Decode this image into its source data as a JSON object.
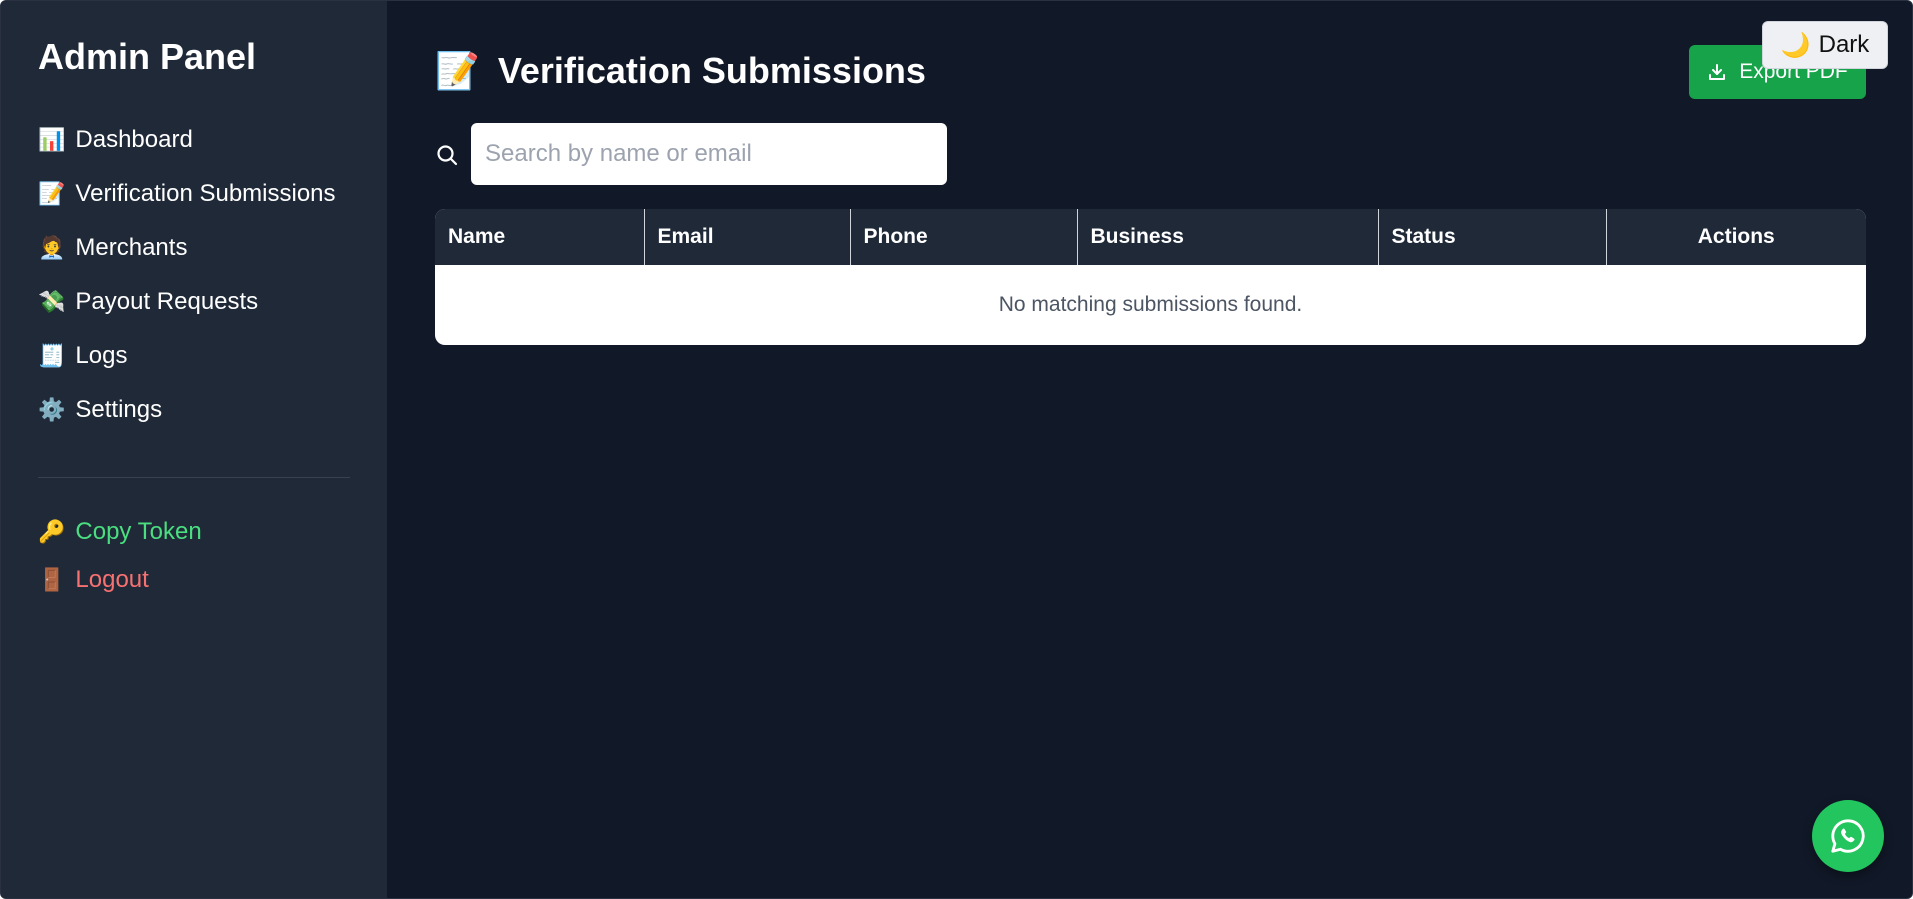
{
  "sidebar": {
    "brand": "Admin Panel",
    "items": [
      {
        "icon": "📊",
        "label": "Dashboard"
      },
      {
        "icon": "📝",
        "label": "Verification Submissions"
      },
      {
        "icon": "🧑‍💼",
        "label": "Merchants"
      },
      {
        "icon": "💸",
        "label": "Payout Requests"
      },
      {
        "icon": "🧾",
        "label": "Logs"
      },
      {
        "icon": "⚙️",
        "label": "Settings"
      }
    ],
    "copy_token": {
      "icon": "🔑",
      "label": "Copy Token"
    },
    "logout": {
      "icon": "🚪",
      "label": "Logout"
    }
  },
  "header": {
    "title_icon": "📝",
    "title": "Verification Submissions",
    "export_label": "Export PDF",
    "theme_icon": "🌙",
    "theme_label": "Dark"
  },
  "search": {
    "placeholder": "Search by name or email",
    "value": ""
  },
  "table": {
    "columns": [
      "Name",
      "Email",
      "Phone",
      "Business",
      "Status",
      "Actions"
    ],
    "empty_message": "No matching submissions found."
  },
  "colors": {
    "sidebar_bg": "#1f2937",
    "main_bg": "#111827",
    "export_button": "#16a34a",
    "copy_token": "#4ade80",
    "logout": "#f87171",
    "whatsapp": "#22c55e"
  },
  "icons": {
    "search": "search-icon",
    "export": "download-icon",
    "chat": "whatsapp-icon"
  }
}
